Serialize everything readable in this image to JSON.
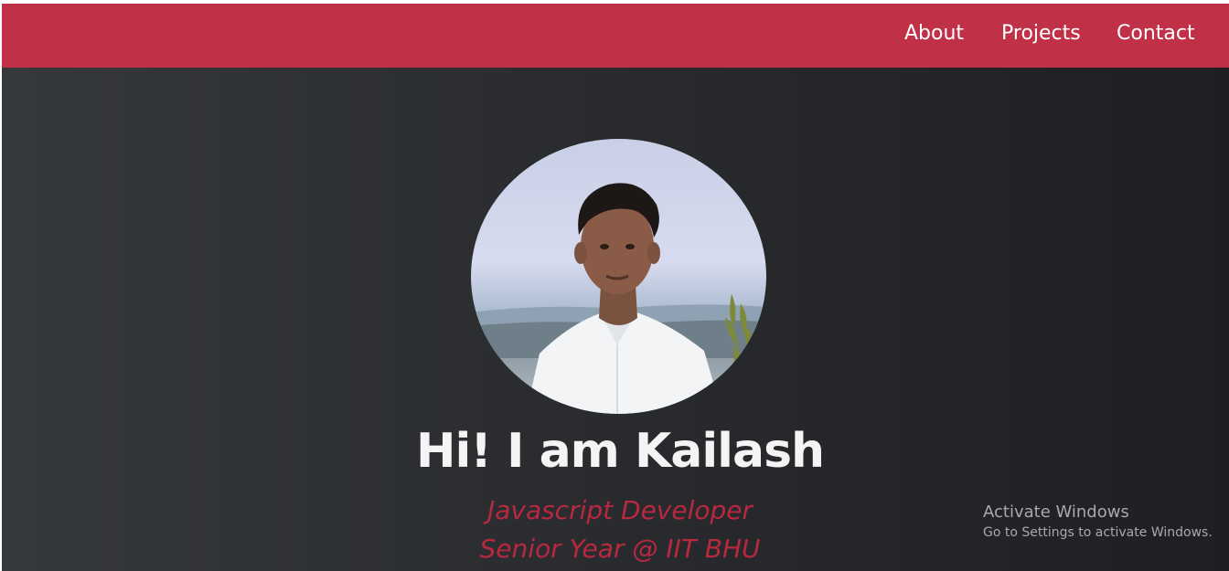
{
  "nav": {
    "links": [
      {
        "label": "About"
      },
      {
        "label": "Projects"
      },
      {
        "label": "Contact"
      }
    ]
  },
  "hero": {
    "headline": "Hi! I am Kailash",
    "subtitle_line1": "Javascript Developer",
    "subtitle_line2": "Senior Year @ IIT BHU",
    "avatar_icon": "profile-photo"
  },
  "watermark": {
    "title": "Activate Windows",
    "subtitle": "Go to Settings to activate Windows."
  },
  "colors": {
    "navbar": "#c03046",
    "accent": "#b8283f",
    "headline": "#f4f4f4",
    "background_dark": "#1e1f22",
    "background_light": "#36393c"
  }
}
